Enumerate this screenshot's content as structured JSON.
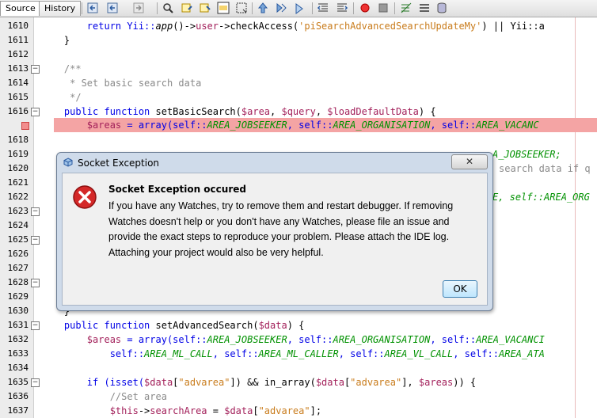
{
  "toolbar": {
    "tab_source": "Source",
    "tab_history": "History"
  },
  "gutter": {
    "lines": [
      "1610",
      "1611",
      "1612",
      "1613",
      "1614",
      "1615",
      "1616",
      "",
      "1618",
      "1619",
      "1620",
      "1621",
      "1622",
      "1623",
      "1624",
      "1625",
      "1626",
      "1627",
      "1628",
      "1629",
      "1630",
      "1631",
      "1632",
      "1633",
      "1634",
      "1635",
      "1636",
      "1637"
    ]
  },
  "code": {
    "l1610a": "        return Yii::",
    "l1610b": "app",
    "l1610c": "()->",
    "l1610d": "user",
    "l1610e": "->checkAccess(",
    "l1610f": "'piSearchAdvancedSearchUpdateMy'",
    "l1610g": ") || Yii::a",
    "l1611": "    }",
    "l1613": "    /**",
    "l1614": "     * Set basic search data",
    "l1615": "     */",
    "l1616a": "    public function ",
    "l1616b": "setBasicSearch",
    "l1616c": "(",
    "l1616d": "$area",
    "l1616e": ", ",
    "l1616f": "$query",
    "l1616g": ", ",
    "l1616h": "$loadDefaultData",
    "l1616i": ") {",
    "l1617a": "        ",
    "l1617b": "$areas",
    "l1617c": " = array(self::",
    "l1617d": "AREA_JOBSEEKER",
    "l1617e": ", self::",
    "l1617f": "AREA_ORGANISATION",
    "l1617g": ", self::",
    "l1617h": "AREA_VACANC",
    "l1619": "A_JOBSEEKER;",
    "l1620": "search data if q",
    "l1622a": "E, self::",
    "l1622b": "AREA_ORG",
    "l1630": "    }",
    "l1631a": "    public function ",
    "l1631b": "setAdvancedSearch",
    "l1631c": "(",
    "l1631d": "$data",
    "l1631e": ") {",
    "l1632a": "        ",
    "l1632b": "$areas",
    "l1632c": " = array(self::",
    "l1632d": "AREA_JOBSEEKER",
    "l1632e": ", self::",
    "l1632f": "AREA_ORGANISATION",
    "l1632g": ", self::",
    "l1632h": "AREA_VACANCI",
    "l1633a": "            self::",
    "l1633b": "AREA_ML_CALL",
    "l1633c": ", self::",
    "l1633d": "AREA_ML_CALLER",
    "l1633e": ", self::",
    "l1633f": "AREA_VL_CALL",
    "l1633g": ", self::",
    "l1633h": "AREA_ATA",
    "l1635a": "        if (isset(",
    "l1635b": "$data",
    "l1635c": "[",
    "l1635d": "\"advarea\"",
    "l1635e": "]) && in_array(",
    "l1635f": "$data",
    "l1635g": "[",
    "l1635h": "\"advarea\"",
    "l1635i": "], ",
    "l1635j": "$areas",
    "l1635k": ")) {",
    "l1636": "            //Set area",
    "l1637a": "            ",
    "l1637b": "$this",
    "l1637c": "->",
    "l1637d": "searchArea",
    "l1637e": " = ",
    "l1637f": "$data",
    "l1637g": "[",
    "l1637h": "\"advarea\"",
    "l1637i": "];"
  },
  "dialog": {
    "title": "Socket Exception",
    "close_label": "✕",
    "message_title": "Socket Exception occured",
    "message_body": "If you have any Watches, try to remove them and restart debugger. If removing Watches doesn't help or you don't have any Watches, please file an issue and provide the exact steps to reproduce your problem. Please attach the IDE log. Attaching your project would also be very helpful.",
    "ok_label": "OK"
  },
  "colors": {
    "breakpoint_line": "#f4a4a4",
    "keyword": "#0000e6",
    "variable": "#a3215b",
    "string": "#c97c1c",
    "constant": "#009100",
    "comment": "#8a8a8a"
  }
}
